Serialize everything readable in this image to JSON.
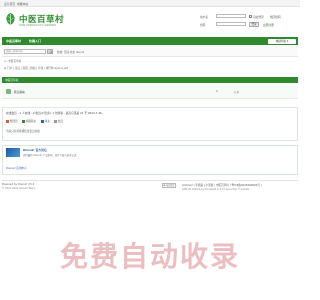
{
  "topbar": {
    "left_links": [
      "设为首页",
      "收藏本站"
    ]
  },
  "logo": {
    "title": "中医百草村",
    "subtitle": "百草园·中医药民间交流平台 中医草药知识"
  },
  "login": {
    "username_label": "用户名",
    "password_label": "密码",
    "remember_label": "自动登录",
    "forgot_label": "找回密码",
    "login_button": "登录",
    "register_label": "立即注册"
  },
  "nav": {
    "items": [
      "中医百草村",
      "快捷入门"
    ],
    "right_button": "快捷导航 ▾"
  },
  "search": {
    "placeholder": "请输入搜索内容",
    "hot_label": "热搜: 活动 交友 discuz"
  },
  "breadcrumb": "⌂ › 中医百草村",
  "breadcrumb2": "☰ 门户 | 论坛 | 家园 | 群组 | 导读 | 排行榜 Gplore_wlt",
  "section": {
    "title": "中医百草村"
  },
  "forum_row": {
    "name": "默认版块",
    "count": "0",
    "last": "从未"
  },
  "stats": {
    "title": "在线会员 - 1 人在线 - 0 会员(0 隐身), 1 位游客 - 最高记录是 21 于 2024-7-26.",
    "legend": [
      {
        "label": "管理员",
        "color": "#e25b2a"
      },
      {
        "label": "超级版主",
        "color": "#3a8a3a"
      },
      {
        "label": "版主",
        "color": "#2a62b8"
      },
      {
        "label": "会员",
        "color": "#999999"
      }
    ],
    "line2": "当前只有游客或隐身会员在线"
  },
  "promo": {
    "title": "Discuz! 官方论坛",
    "desc": "提供最新 Discuz! 产品新闻、软件下载与技术交流",
    "link": "Discuz! 应用中心"
  },
  "footer": {
    "powered": "Powered by Discuz! X3.4",
    "copyright": "© 2001-2024 Discuz! Team.",
    "badge": "⬒ 站长统计",
    "links": "Archiver | 手机版 | 小黑屋 | 中医百草村 ( 粤ICP备2024000000号 )",
    "gmt": "GMT+8, 2024-9-6 | Processed in 0.07 second(s), 3 queries."
  },
  "watermark": "免费自动收录"
}
